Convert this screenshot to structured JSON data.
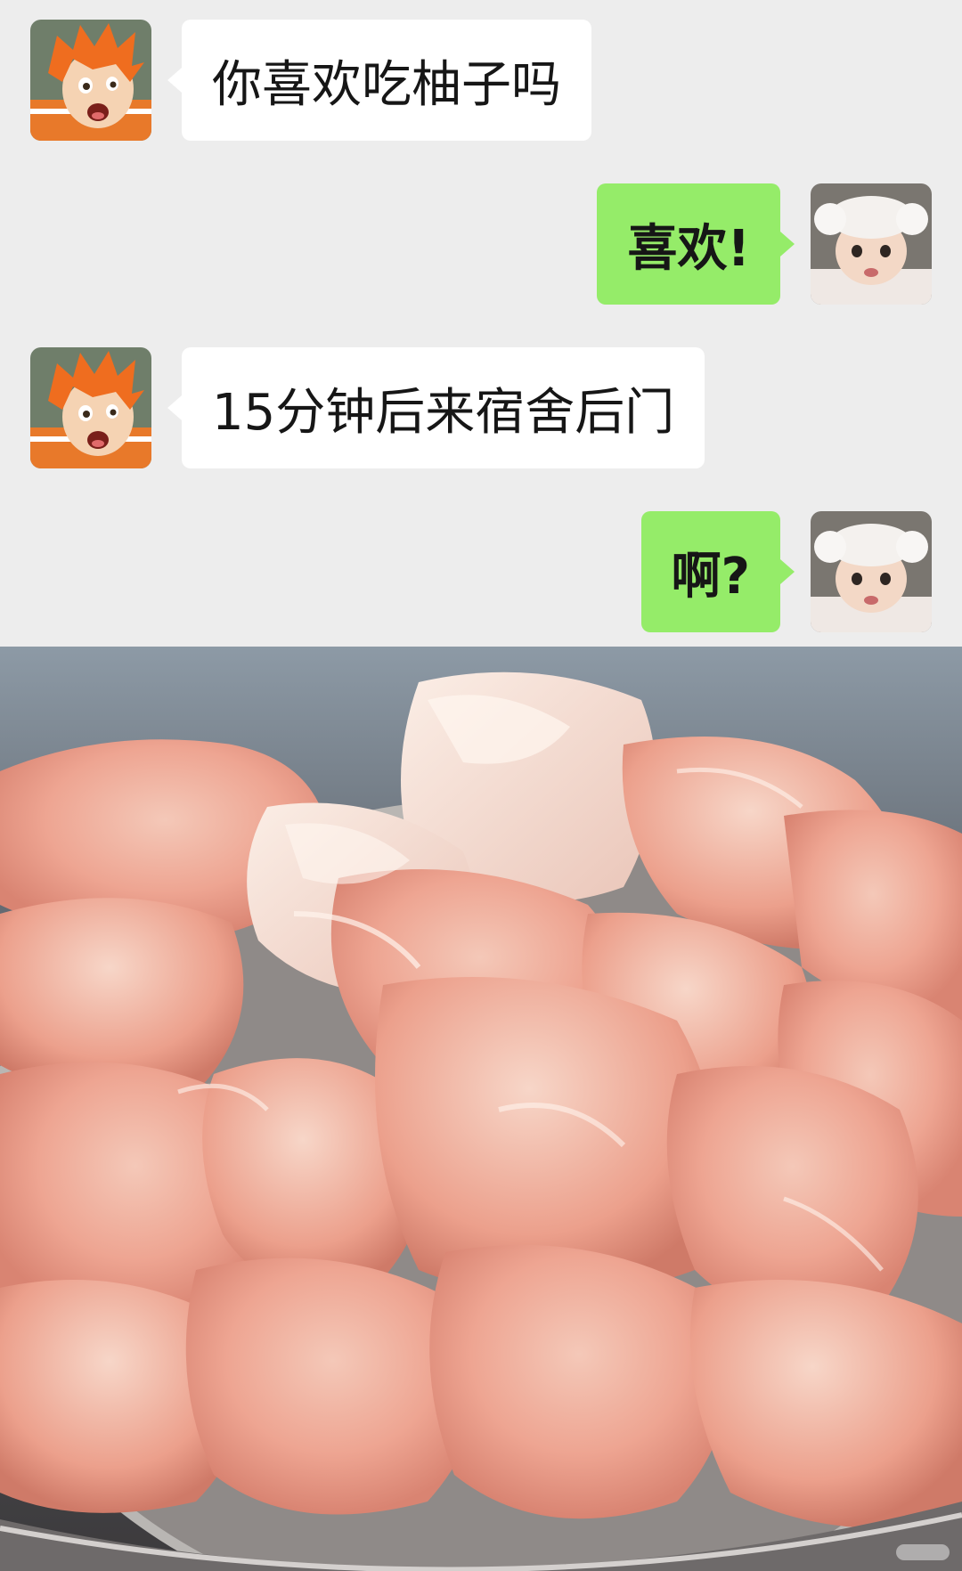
{
  "chat": {
    "messages": [
      {
        "sender": "other",
        "text": "你喜欢吃柚子吗"
      },
      {
        "sender": "me",
        "text": "喜欢!"
      },
      {
        "sender": "other",
        "text": "15分钟后来宿舍后门"
      },
      {
        "sender": "me",
        "text": "啊?"
      }
    ]
  },
  "colors": {
    "chat_background": "#ededed",
    "incoming_bubble": "#ffffff",
    "outgoing_bubble": "#95ec69",
    "text": "#161616"
  },
  "icons": {
    "other_avatar": "anime-boy-orange-hair-avatar",
    "my_avatar": "child-white-hat-avatar"
  },
  "photo": {
    "subject": "peeled pomelo segments in a metal bowl"
  }
}
